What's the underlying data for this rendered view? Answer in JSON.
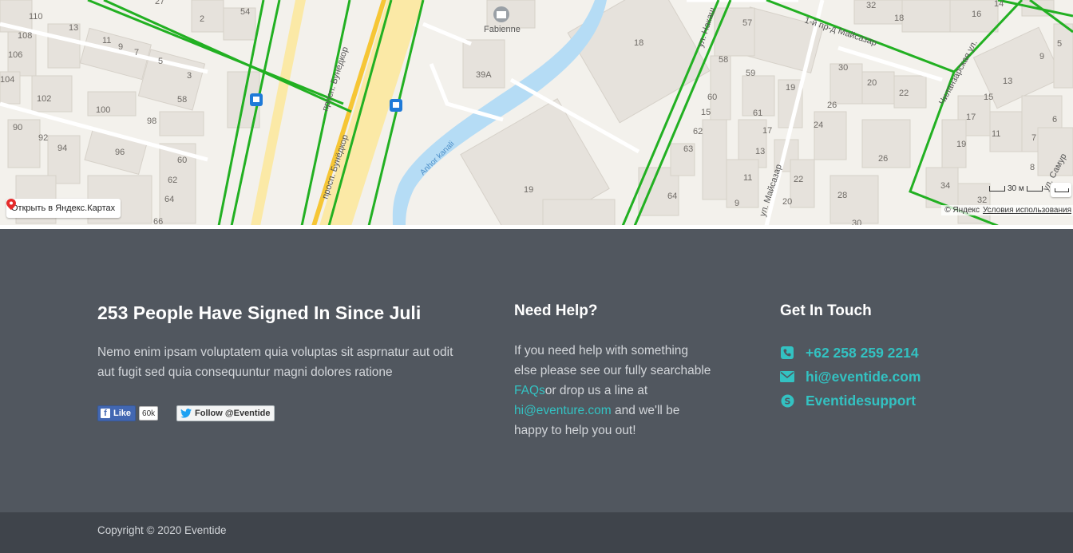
{
  "map": {
    "open_button_label": "Открыть в Яндекс.Картах",
    "copyright": "© Яндекс",
    "terms_link": "Условия использования",
    "scale_label": "30 м",
    "poi_label": "Fabienne",
    "canal_label": "Anhor kanali",
    "streets": {
      "prospect_1": "просп. Бунёдкор",
      "prospect_2": "просп. Бунёдкор",
      "ul_naka": "ул. Накаш",
      "maysazar_proezd": "1-й пр-д Майсазар",
      "ul_maysazar": "ул. Майсазар",
      "ul_chilan": "Чиланзарская ул.",
      "ul_samur": "ул. Самур"
    },
    "building_numbers": [
      "110",
      "13",
      "108",
      "106",
      "104",
      "102",
      "11",
      "9",
      "7",
      "5",
      "3",
      "100",
      "98",
      "90",
      "92",
      "94",
      "96",
      "60",
      "58",
      "62",
      "64",
      "66",
      "27",
      "2",
      "54",
      "39A",
      "18",
      "19",
      "57",
      "58",
      "59",
      "60",
      "15",
      "62",
      "63",
      "61",
      "17",
      "13",
      "11",
      "9",
      "64",
      "30",
      "26",
      "20",
      "22",
      "24",
      "19",
      "26",
      "22",
      "28",
      "32",
      "18",
      "16",
      "14",
      "13",
      "15",
      "17",
      "11",
      "19",
      "7",
      "8",
      "6",
      "9",
      "5",
      "34",
      "32",
      "30",
      "20"
    ]
  },
  "footer": {
    "about": {
      "title": "253 People Have Signed In Since Juli",
      "text": "Nemo enim ipsam voluptatem quia voluptas sit asprnatur aut odit aut fugit sed quia consequuntur magni dolores ratione"
    },
    "social": {
      "fb_like_label": "Like",
      "fb_like_count": "60k",
      "twitter_follow_label": "Follow @Eventide"
    },
    "help": {
      "title": "Need Help?",
      "text_1": "If you need help with something else please see our fully searchable ",
      "faqs_link": "FAQs",
      "text_2": "or drop us a line at ",
      "email_link": "hi@eventure.com",
      "text_3": " and we'll be happy to help you out!"
    },
    "touch": {
      "title": "Get In Touch",
      "phone": "+62 258 259 2214",
      "email": "hi@eventide.com",
      "skype": "Eventidesupport"
    },
    "copyright": "Copyright © 2020 Eventide"
  },
  "colors": {
    "footer_bg": "#51575f",
    "footer_bottom_bg": "#3f444b",
    "accent": "#33c2c2",
    "map_bg": "#f3f1ec",
    "road_green": "#22b022",
    "road_yellow": "#f6c635",
    "canal_blue": "#b5dcf5"
  },
  "icons": {
    "map_pin": "map-pin-icon",
    "bus_stop": "bus-stop-icon",
    "poi": "factory-icon",
    "phone": "phone-icon",
    "email": "envelope-icon",
    "skype": "skype-icon",
    "facebook": "facebook-icon",
    "twitter": "twitter-icon"
  }
}
